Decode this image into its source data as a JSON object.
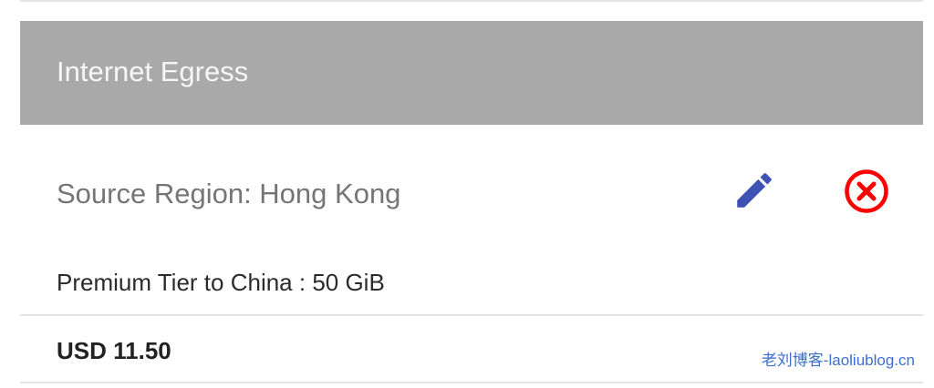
{
  "section": {
    "title": "Internet Egress"
  },
  "item": {
    "title": "Source Region: Hong Kong",
    "detail": "Premium Tier to China : 50 GiB",
    "price": "USD 11.50",
    "edit_icon": "pencil-icon",
    "remove_icon": "close-circle-icon"
  },
  "watermark": {
    "text": "老刘博客-laoliublog.cn"
  },
  "colors": {
    "header_bg": "#a9a9a9",
    "edit": "#3f51b5",
    "remove": "#ff0000",
    "watermark": "#3b6fd0"
  }
}
